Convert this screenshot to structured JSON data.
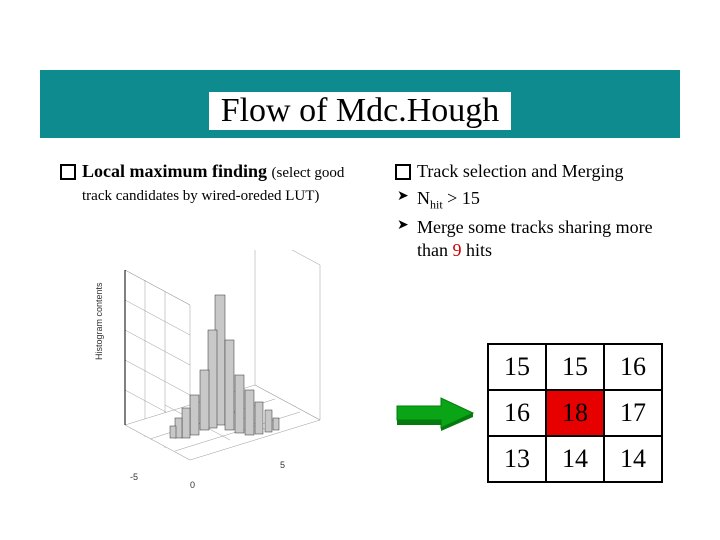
{
  "title": "Flow of Mdc.Hough",
  "left": {
    "heading_bold": "Local maximum finding ",
    "heading_rest": "(select good track candidates by wired-oreded LUT)",
    "plot_ylabel": "Histogram contents"
  },
  "right": {
    "heading": "Track selection and Merging",
    "rule1_pre": "N",
    "rule1_sub": "hit",
    "rule1_post": " > 15",
    "rule2_pre": "Merge some tracks sharing more than ",
    "rule2_count": "9",
    "rule2_post": " hits"
  },
  "grid": {
    "r0": [
      "15",
      "15",
      "16"
    ],
    "r1": [
      "16",
      "18",
      "17"
    ],
    "r2": [
      "13",
      "14",
      "14"
    ]
  }
}
